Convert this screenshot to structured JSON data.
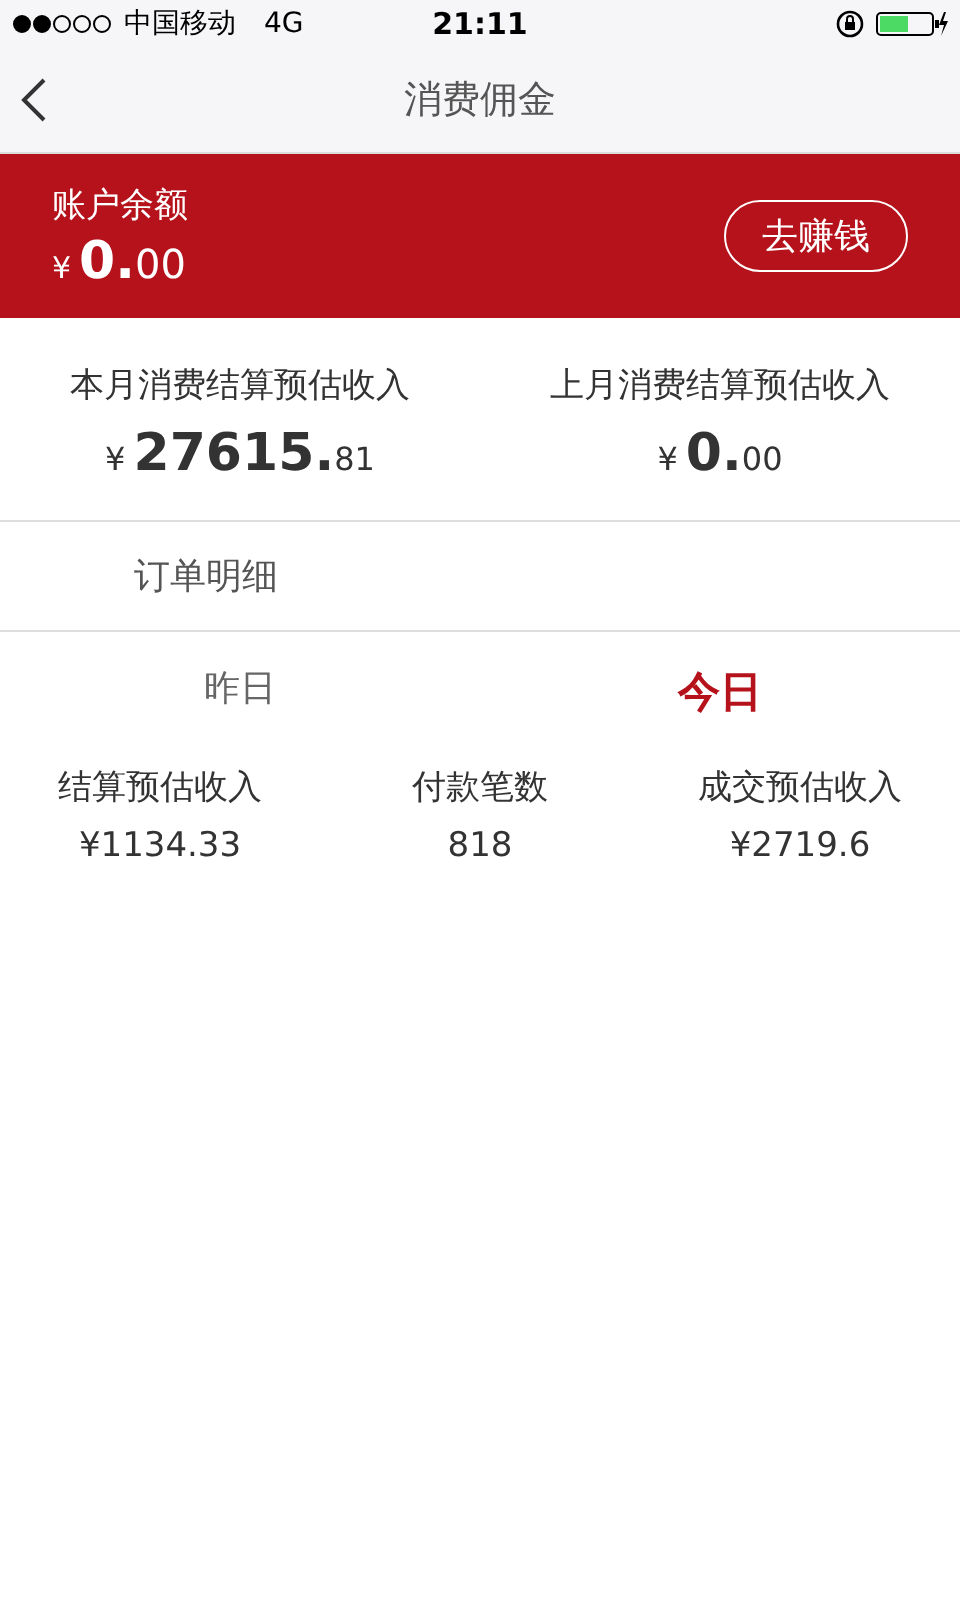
{
  "status_bar": {
    "carrier": "中国移动",
    "network": "4G",
    "time": "21:11"
  },
  "nav": {
    "title": "消费佣金"
  },
  "balance": {
    "label": "账户余额",
    "currency": "¥",
    "integer": "0.",
    "decimals": "00",
    "button": "去赚钱"
  },
  "summary": [
    {
      "label": "本月消费结算预估收入",
      "currency": "¥",
      "integer": "27615.",
      "decimals": "81"
    },
    {
      "label": "上月消费结算预估收入",
      "currency": "¥",
      "integer": "0.",
      "decimals": "00"
    }
  ],
  "order_detail": {
    "label": "订单明细"
  },
  "day_tabs": [
    {
      "label": "昨日",
      "selected": false
    },
    {
      "label": "今日",
      "selected": true
    }
  ],
  "stats": [
    {
      "label": "结算预估收入",
      "value": "¥1134.33"
    },
    {
      "label": "付款笔数",
      "value": "818"
    },
    {
      "label": "成交预估收入",
      "value": "¥2719.6"
    }
  ]
}
